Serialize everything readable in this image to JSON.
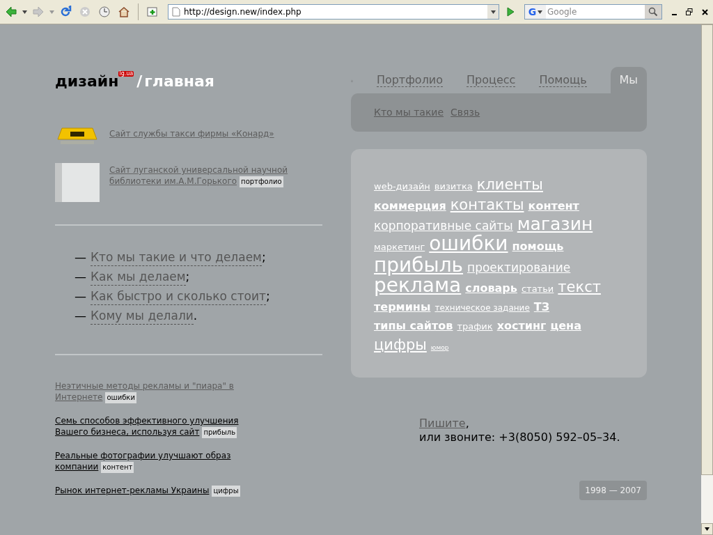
{
  "browser": {
    "url": "http://design.new/index.php",
    "search_engine": "G",
    "search_placeholder": "Google"
  },
  "logo": {
    "name": "дизайн",
    "badge": "lg.ua",
    "separator": "/",
    "page": "главная"
  },
  "nav": {
    "tabs": [
      {
        "label": "Портфолио",
        "selected": false
      },
      {
        "label": "Процесс",
        "selected": false
      },
      {
        "label": "Помощь",
        "selected": false
      },
      {
        "label": "Мы",
        "selected": true
      }
    ],
    "subnav": [
      "Кто мы такие",
      "Связь"
    ]
  },
  "portfolio": [
    {
      "kind": "taxi",
      "title": "Сайт службы такси фирмы «Конард»"
    },
    {
      "kind": "library",
      "title": "Сайт луганской универсальной научной библиотеки им.А.М.Горького",
      "tag": "портфолио"
    }
  ],
  "about_list": [
    {
      "marker": "—",
      "link": "Кто мы такие и что делаем",
      "punct": ";"
    },
    {
      "marker": "—",
      "link": "Как мы делаем",
      "punct": ";"
    },
    {
      "marker": "—",
      "link": "Как быстро и сколько стоит",
      "punct": ";"
    },
    {
      "marker": "—",
      "link": "Кому мы делали",
      "punct": "."
    }
  ],
  "articles": [
    {
      "title": "Неэтичные методы рекламы и \"пиара\" в Интернете",
      "tag": "ошибки",
      "visited": true
    },
    {
      "title": "Семь способов эффективного улучшения Вашего бизнеса, используя сайт",
      "tag": "прибыль",
      "visited": false
    },
    {
      "title": "Реальные фотографии улучшают образ компании",
      "tag": "контент",
      "visited": false
    },
    {
      "title": "Рынок интернет-рекламы Украины",
      "tag": "цифры",
      "visited": false
    }
  ],
  "tag_cloud": [
    {
      "label": "web-дизайн",
      "kind": "s"
    },
    {
      "label": "визитка",
      "kind": "s"
    },
    {
      "label": "клиенты",
      "kind": "l"
    },
    {
      "label": "коммерция",
      "kind": "mb"
    },
    {
      "label": "контакты",
      "kind": "l"
    },
    {
      "label": "контент",
      "kind": "mb"
    },
    {
      "label": "корпоративные сайты",
      "kind": "m"
    },
    {
      "label": "магазин",
      "kind": "xl"
    },
    {
      "label": "маркетинг",
      "kind": "s"
    },
    {
      "label": "ошибки",
      "kind": "xxl"
    },
    {
      "label": "помощь",
      "kind": "mb"
    },
    {
      "label": "прибыль",
      "kind": "xxl"
    },
    {
      "label": "проектирование",
      "kind": "m"
    },
    {
      "label": "реклама",
      "kind": "xxl"
    },
    {
      "label": "словарь",
      "kind": "mb"
    },
    {
      "label": "статьи",
      "kind": "s"
    },
    {
      "label": "текст",
      "kind": "l"
    },
    {
      "label": "термины",
      "kind": "mb"
    },
    {
      "label": "техническое задание",
      "kind": "xs"
    },
    {
      "label": "ТЗ",
      "kind": "mb"
    },
    {
      "label": "типы сайтов",
      "kind": "mb"
    },
    {
      "label": "трафик",
      "kind": "s"
    },
    {
      "label": "хостинг",
      "kind": "mb"
    },
    {
      "label": "цена",
      "kind": "mb"
    },
    {
      "label": "цифры",
      "kind": "l"
    },
    {
      "label": "юмор",
      "kind": "xxs"
    }
  ],
  "contact": {
    "link": "Пишите",
    "comma": ",",
    "text": "или звоните: +3(8050) 592–05–34."
  },
  "footer": "1998 — 2007"
}
